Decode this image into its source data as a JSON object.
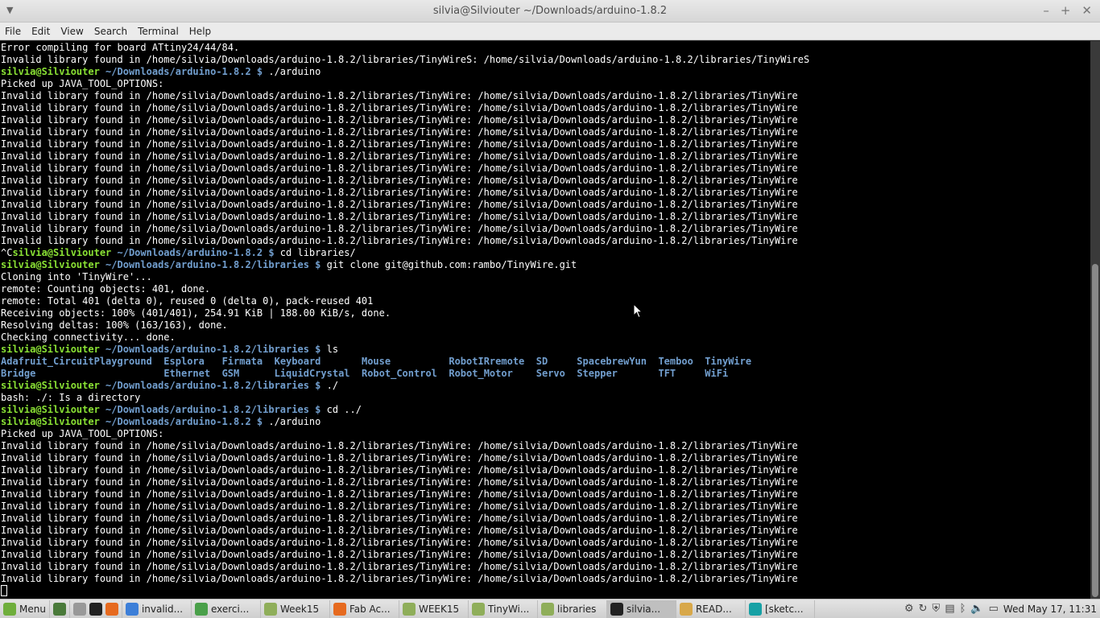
{
  "window": {
    "title": "silvia@Silviouter ~/Downloads/arduino-1.8.2"
  },
  "menubar": [
    "File",
    "Edit",
    "View",
    "Search",
    "Terminal",
    "Help"
  ],
  "terminal_lines": [
    [
      {
        "t": "Error compiling for board ATtiny24/44/84."
      }
    ],
    [
      {
        "t": "Invalid library found in /home/silvia/Downloads/arduino-1.8.2/libraries/TinyWireS: /home/silvia/Downloads/arduino-1.8.2/libraries/TinyWireS"
      }
    ],
    [
      {
        "t": "silvia@Silviouter",
        "c": "user"
      },
      {
        "t": " ~/Downloads/arduino-1.8.2 $",
        "c": "path"
      },
      {
        "t": " ./arduino"
      }
    ],
    [
      {
        "t": "Picked up JAVA_TOOL_OPTIONS:"
      }
    ],
    [
      {
        "t": "Invalid library found in /home/silvia/Downloads/arduino-1.8.2/libraries/TinyWire: /home/silvia/Downloads/arduino-1.8.2/libraries/TinyWire"
      }
    ],
    [
      {
        "t": "Invalid library found in /home/silvia/Downloads/arduino-1.8.2/libraries/TinyWire: /home/silvia/Downloads/arduino-1.8.2/libraries/TinyWire"
      }
    ],
    [
      {
        "t": "Invalid library found in /home/silvia/Downloads/arduino-1.8.2/libraries/TinyWire: /home/silvia/Downloads/arduino-1.8.2/libraries/TinyWire"
      }
    ],
    [
      {
        "t": "Invalid library found in /home/silvia/Downloads/arduino-1.8.2/libraries/TinyWire: /home/silvia/Downloads/arduino-1.8.2/libraries/TinyWire"
      }
    ],
    [
      {
        "t": "Invalid library found in /home/silvia/Downloads/arduino-1.8.2/libraries/TinyWire: /home/silvia/Downloads/arduino-1.8.2/libraries/TinyWire"
      }
    ],
    [
      {
        "t": "Invalid library found in /home/silvia/Downloads/arduino-1.8.2/libraries/TinyWire: /home/silvia/Downloads/arduino-1.8.2/libraries/TinyWire"
      }
    ],
    [
      {
        "t": "Invalid library found in /home/silvia/Downloads/arduino-1.8.2/libraries/TinyWire: /home/silvia/Downloads/arduino-1.8.2/libraries/TinyWire"
      }
    ],
    [
      {
        "t": "Invalid library found in /home/silvia/Downloads/arduino-1.8.2/libraries/TinyWire: /home/silvia/Downloads/arduino-1.8.2/libraries/TinyWire"
      }
    ],
    [
      {
        "t": "Invalid library found in /home/silvia/Downloads/arduino-1.8.2/libraries/TinyWire: /home/silvia/Downloads/arduino-1.8.2/libraries/TinyWire"
      }
    ],
    [
      {
        "t": "Invalid library found in /home/silvia/Downloads/arduino-1.8.2/libraries/TinyWire: /home/silvia/Downloads/arduino-1.8.2/libraries/TinyWire"
      }
    ],
    [
      {
        "t": "Invalid library found in /home/silvia/Downloads/arduino-1.8.2/libraries/TinyWire: /home/silvia/Downloads/arduino-1.8.2/libraries/TinyWire"
      }
    ],
    [
      {
        "t": "Invalid library found in /home/silvia/Downloads/arduino-1.8.2/libraries/TinyWire: /home/silvia/Downloads/arduino-1.8.2/libraries/TinyWire"
      }
    ],
    [
      {
        "t": "Invalid library found in /home/silvia/Downloads/arduino-1.8.2/libraries/TinyWire: /home/silvia/Downloads/arduino-1.8.2/libraries/TinyWire"
      }
    ],
    [
      {
        "t": "^C"
      },
      {
        "t": "silvia@Silviouter",
        "c": "user"
      },
      {
        "t": " ~/Downloads/arduino-1.8.2 $",
        "c": "path"
      },
      {
        "t": " cd libraries/"
      }
    ],
    [
      {
        "t": "silvia@Silviouter",
        "c": "user"
      },
      {
        "t": " ~/Downloads/arduino-1.8.2/libraries $",
        "c": "path"
      },
      {
        "t": " git clone git@github.com:rambo/TinyWire.git"
      }
    ],
    [
      {
        "t": "Cloning into 'TinyWire'..."
      }
    ],
    [
      {
        "t": "remote: Counting objects: 401, done."
      }
    ],
    [
      {
        "t": "remote: Total 401 (delta 0), reused 0 (delta 0), pack-reused 401"
      }
    ],
    [
      {
        "t": "Receiving objects: 100% (401/401), 254.91 KiB | 188.00 KiB/s, done."
      }
    ],
    [
      {
        "t": "Resolving deltas: 100% (163/163), done."
      }
    ],
    [
      {
        "t": "Checking connectivity... done."
      }
    ],
    [
      {
        "t": "silvia@Silviouter",
        "c": "user"
      },
      {
        "t": " ~/Downloads/arduino-1.8.2/libraries $",
        "c": "path"
      },
      {
        "t": " ls"
      }
    ],
    [
      {
        "t": "Adafruit_CircuitPlayground",
        "c": "dir"
      },
      {
        "t": "  "
      },
      {
        "t": "Esplora",
        "c": "dir"
      },
      {
        "t": "   "
      },
      {
        "t": "Firmata",
        "c": "dir"
      },
      {
        "t": "  "
      },
      {
        "t": "Keyboard",
        "c": "dir"
      },
      {
        "t": "       "
      },
      {
        "t": "Mouse",
        "c": "dir"
      },
      {
        "t": "          "
      },
      {
        "t": "RobotIRremote",
        "c": "dir"
      },
      {
        "t": "  "
      },
      {
        "t": "SD",
        "c": "dir"
      },
      {
        "t": "     "
      },
      {
        "t": "SpacebrewYun",
        "c": "dir"
      },
      {
        "t": "  "
      },
      {
        "t": "Temboo",
        "c": "dir"
      },
      {
        "t": "  "
      },
      {
        "t": "TinyWire",
        "c": "dir"
      }
    ],
    [
      {
        "t": "Bridge",
        "c": "dir"
      },
      {
        "t": "                      "
      },
      {
        "t": "Ethernet",
        "c": "dir"
      },
      {
        "t": "  "
      },
      {
        "t": "GSM",
        "c": "dir"
      },
      {
        "t": "      "
      },
      {
        "t": "LiquidCrystal",
        "c": "dir"
      },
      {
        "t": "  "
      },
      {
        "t": "Robot_Control",
        "c": "dir"
      },
      {
        "t": "  "
      },
      {
        "t": "Robot_Motor",
        "c": "dir"
      },
      {
        "t": "    "
      },
      {
        "t": "Servo",
        "c": "dir"
      },
      {
        "t": "  "
      },
      {
        "t": "Stepper",
        "c": "dir"
      },
      {
        "t": "       "
      },
      {
        "t": "TFT",
        "c": "dir"
      },
      {
        "t": "     "
      },
      {
        "t": "WiFi",
        "c": "dir"
      }
    ],
    [
      {
        "t": "silvia@Silviouter",
        "c": "user"
      },
      {
        "t": " ~/Downloads/arduino-1.8.2/libraries $",
        "c": "path"
      },
      {
        "t": " ./"
      }
    ],
    [
      {
        "t": "bash: ./: Is a directory"
      }
    ],
    [
      {
        "t": "silvia@Silviouter",
        "c": "user"
      },
      {
        "t": " ~/Downloads/arduino-1.8.2/libraries $",
        "c": "path"
      },
      {
        "t": " cd ../"
      }
    ],
    [
      {
        "t": "silvia@Silviouter",
        "c": "user"
      },
      {
        "t": " ~/Downloads/arduino-1.8.2 $",
        "c": "path"
      },
      {
        "t": " ./arduino"
      }
    ],
    [
      {
        "t": "Picked up JAVA_TOOL_OPTIONS:"
      }
    ],
    [
      {
        "t": "Invalid library found in /home/silvia/Downloads/arduino-1.8.2/libraries/TinyWire: /home/silvia/Downloads/arduino-1.8.2/libraries/TinyWire"
      }
    ],
    [
      {
        "t": "Invalid library found in /home/silvia/Downloads/arduino-1.8.2/libraries/TinyWire: /home/silvia/Downloads/arduino-1.8.2/libraries/TinyWire"
      }
    ],
    [
      {
        "t": "Invalid library found in /home/silvia/Downloads/arduino-1.8.2/libraries/TinyWire: /home/silvia/Downloads/arduino-1.8.2/libraries/TinyWire"
      }
    ],
    [
      {
        "t": "Invalid library found in /home/silvia/Downloads/arduino-1.8.2/libraries/TinyWire: /home/silvia/Downloads/arduino-1.8.2/libraries/TinyWire"
      }
    ],
    [
      {
        "t": "Invalid library found in /home/silvia/Downloads/arduino-1.8.2/libraries/TinyWire: /home/silvia/Downloads/arduino-1.8.2/libraries/TinyWire"
      }
    ],
    [
      {
        "t": "Invalid library found in /home/silvia/Downloads/arduino-1.8.2/libraries/TinyWire: /home/silvia/Downloads/arduino-1.8.2/libraries/TinyWire"
      }
    ],
    [
      {
        "t": "Invalid library found in /home/silvia/Downloads/arduino-1.8.2/libraries/TinyWire: /home/silvia/Downloads/arduino-1.8.2/libraries/TinyWire"
      }
    ],
    [
      {
        "t": "Invalid library found in /home/silvia/Downloads/arduino-1.8.2/libraries/TinyWire: /home/silvia/Downloads/arduino-1.8.2/libraries/TinyWire"
      }
    ],
    [
      {
        "t": "Invalid library found in /home/silvia/Downloads/arduino-1.8.2/libraries/TinyWire: /home/silvia/Downloads/arduino-1.8.2/libraries/TinyWire"
      }
    ],
    [
      {
        "t": "Invalid library found in /home/silvia/Downloads/arduino-1.8.2/libraries/TinyWire: /home/silvia/Downloads/arduino-1.8.2/libraries/TinyWire"
      }
    ],
    [
      {
        "t": "Invalid library found in /home/silvia/Downloads/arduino-1.8.2/libraries/TinyWire: /home/silvia/Downloads/arduino-1.8.2/libraries/TinyWire"
      }
    ],
    [
      {
        "t": "Invalid library found in /home/silvia/Downloads/arduino-1.8.2/libraries/TinyWire: /home/silvia/Downloads/arduino-1.8.2/libraries/TinyWire"
      }
    ]
  ],
  "taskbar": {
    "menu_label": "Menu",
    "items": [
      {
        "label": "invalid...",
        "icon": "chrome-icon",
        "color": "#3d7fd8"
      },
      {
        "label": "exerci...",
        "icon": "chrome-icon",
        "color": "#4aa04a"
      },
      {
        "label": "Week15",
        "icon": "folder-icon",
        "color": "#8fae5a"
      },
      {
        "label": "Fab Ac...",
        "icon": "firefox-icon",
        "color": "#e66a1f"
      },
      {
        "label": "WEEK15",
        "icon": "folder-icon",
        "color": "#8fae5a"
      },
      {
        "label": "TinyWi...",
        "icon": "folder-icon",
        "color": "#8fae5a"
      },
      {
        "label": "libraries",
        "icon": "folder-icon",
        "color": "#8fae5a"
      },
      {
        "label": "silvia...",
        "icon": "terminal-icon",
        "color": "#222222",
        "active": true
      },
      {
        "label": "READ...",
        "icon": "text-editor-icon",
        "color": "#d8a84a"
      },
      {
        "label": "[sketc...",
        "icon": "arduino-icon",
        "color": "#17a1a5"
      }
    ],
    "clock": "Wed May 17, 11:31"
  },
  "colors": {
    "terminal_bg": "#000000",
    "prompt_user": "#8ae234",
    "prompt_path": "#729fcf"
  }
}
